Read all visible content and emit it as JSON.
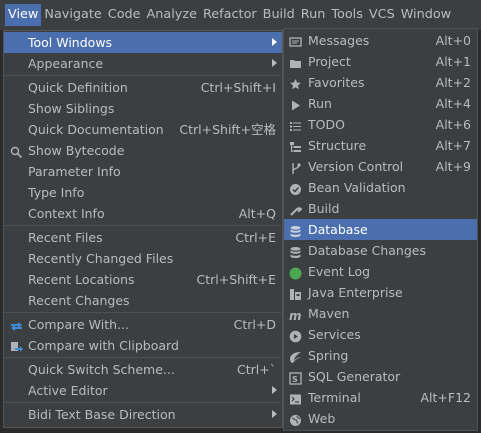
{
  "menubar": [
    {
      "label": "View",
      "u": "V",
      "rest": "iew",
      "active": true
    },
    {
      "label": "Navigate",
      "u": "N",
      "rest": "avigate"
    },
    {
      "label": "Code",
      "u": "C",
      "rest": "ode"
    },
    {
      "label": "Analyze",
      "u": "",
      "rest": "Analyze"
    },
    {
      "label": "Refactor",
      "u": "R",
      "rest": "efactor"
    },
    {
      "label": "Build",
      "u": "B",
      "rest": "uild"
    },
    {
      "label": "Run",
      "u": "",
      "rest": "Run"
    },
    {
      "label": "Tools",
      "u": "T",
      "rest": "ools"
    },
    {
      "label": "VCS",
      "u": "S",
      "rest": "VC"
    },
    {
      "label": "Window",
      "u": "W",
      "rest": "indow"
    }
  ],
  "view_menu": [
    {
      "label": "Tool Windows",
      "shortcut": "",
      "submenu": true,
      "selected": true
    },
    {
      "label": "Appearance",
      "shortcut": "",
      "submenu": true
    },
    {
      "separator": true
    },
    {
      "label": "Quick Definition",
      "shortcut": "Ctrl+Shift+I"
    },
    {
      "label": "Show Siblings",
      "shortcut": ""
    },
    {
      "label": "Quick Documentation",
      "shortcut": "Ctrl+Shift+空格"
    },
    {
      "label": "Show Bytecode",
      "shortcut": "",
      "icon": "bytecode-icon"
    },
    {
      "label": "Parameter Info",
      "shortcut": ""
    },
    {
      "label": "Type Info",
      "shortcut": ""
    },
    {
      "label": "Context Info",
      "shortcut": "Alt+Q"
    },
    {
      "separator": true
    },
    {
      "label": "Recent Files",
      "shortcut": "Ctrl+E"
    },
    {
      "label": "Recently Changed Files",
      "shortcut": ""
    },
    {
      "label": "Recent Locations",
      "shortcut": "Ctrl+Shift+E"
    },
    {
      "label": "Recent Changes",
      "shortcut": ""
    },
    {
      "separator": true
    },
    {
      "label": "Compare With...",
      "shortcut": "Ctrl+D",
      "icon": "compare-icon"
    },
    {
      "label": "Compare with Clipboard",
      "shortcut": "",
      "icon": "compare-clipboard-icon"
    },
    {
      "separator": true
    },
    {
      "label": "Quick Switch Scheme...",
      "shortcut": "Ctrl+`"
    },
    {
      "label": "Active Editor",
      "shortcut": "",
      "submenu": true
    },
    {
      "separator": true
    },
    {
      "label": "Bidi Text Base Direction",
      "shortcut": "",
      "submenu": true
    }
  ],
  "tool_windows_menu": [
    {
      "label": "Messages",
      "shortcut": "Alt+0",
      "icon": "messages-icon"
    },
    {
      "label": "Project",
      "shortcut": "Alt+1",
      "icon": "folder-icon"
    },
    {
      "label": "Favorites",
      "shortcut": "Alt+2",
      "icon": "star-icon"
    },
    {
      "label": "Run",
      "shortcut": "Alt+4",
      "icon": "run-icon"
    },
    {
      "label": "TODO",
      "shortcut": "Alt+6",
      "icon": "todo-icon"
    },
    {
      "label": "Structure",
      "shortcut": "Alt+7",
      "icon": "structure-icon"
    },
    {
      "label": "Version Control",
      "shortcut": "Alt+9",
      "icon": "version-control-icon"
    },
    {
      "label": "Bean Validation",
      "shortcut": "",
      "icon": "bean-validation-icon"
    },
    {
      "label": "Build",
      "shortcut": "",
      "icon": "build-icon"
    },
    {
      "label": "Database",
      "shortcut": "",
      "icon": "database-icon",
      "selected": true
    },
    {
      "label": "Database Changes",
      "shortcut": "",
      "icon": "database-changes-icon"
    },
    {
      "label": "Event Log",
      "shortcut": "",
      "icon": "event-log-icon"
    },
    {
      "label": "Java Enterprise",
      "shortcut": "",
      "icon": "java-enterprise-icon"
    },
    {
      "label": "Maven",
      "shortcut": "",
      "icon": "maven-icon"
    },
    {
      "label": "Services",
      "shortcut": "",
      "icon": "services-icon"
    },
    {
      "label": "Spring",
      "shortcut": "",
      "icon": "spring-icon"
    },
    {
      "label": "SQL Generator",
      "shortcut": "",
      "icon": "sql-generator-icon"
    },
    {
      "label": "Terminal",
      "shortcut": "Alt+F12",
      "icon": "terminal-icon"
    },
    {
      "label": "Web",
      "shortcut": "",
      "icon": "web-icon"
    }
  ],
  "colors": {
    "accent": "#4b6eaf",
    "menu_bg": "#3c3f41",
    "text": "#bbbbbb"
  }
}
